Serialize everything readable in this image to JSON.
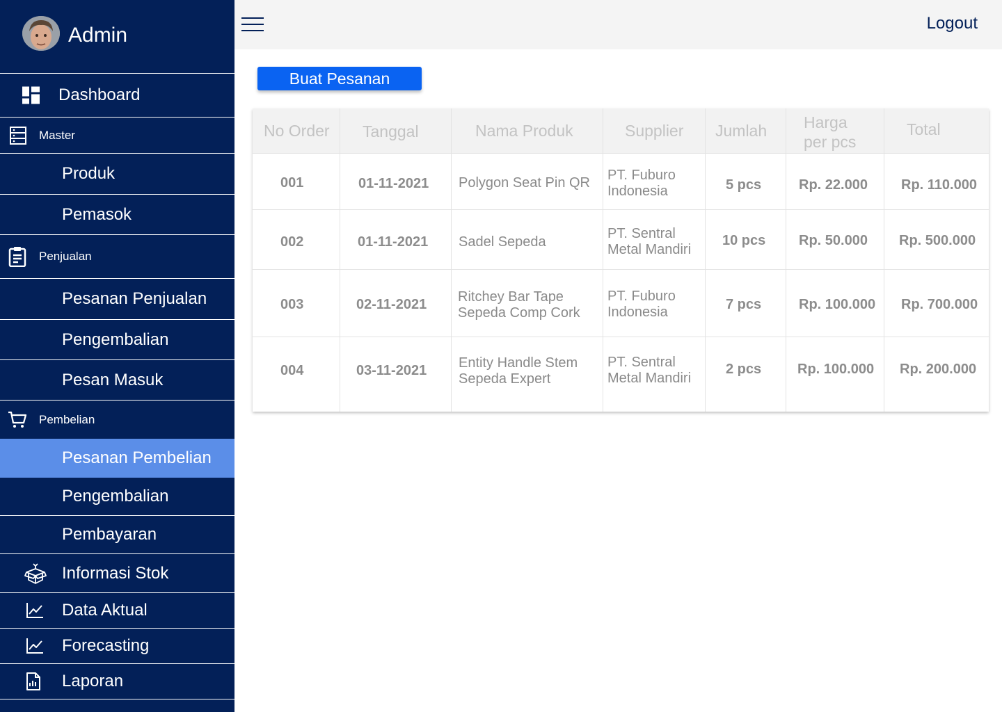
{
  "sidebar": {
    "admin_name": "Admin",
    "items": [
      {
        "label": "Dashboard",
        "icon": "dashboard-grid-icon"
      },
      {
        "label": "Master",
        "icon": "server-list-icon"
      },
      {
        "label": "Produk"
      },
      {
        "label": "Pemasok"
      },
      {
        "label": "Penjualan",
        "icon": "clipboard-icon"
      },
      {
        "label": "Pesanan Penjualan"
      },
      {
        "label": "Pengembalian"
      },
      {
        "label": "Pesan Masuk"
      },
      {
        "label": "Pembelian",
        "icon": "cart-icon"
      },
      {
        "label": "Pesanan Pembelian",
        "active": true
      },
      {
        "label": "Pengembalian"
      },
      {
        "label": "Pembayaran"
      },
      {
        "label": "Informasi Stok",
        "icon": "box-icon"
      },
      {
        "label": "Data Aktual",
        "icon": "line-chart-icon"
      },
      {
        "label": "Forecasting",
        "icon": "line-chart-icon"
      },
      {
        "label": "Laporan",
        "icon": "report-icon"
      }
    ]
  },
  "topbar": {
    "logout_label": "Logout"
  },
  "main": {
    "create_button_label": "Buat Pesanan",
    "table": {
      "headers": [
        "No Order",
        "Tanggal",
        "Nama Produk",
        "Supplier",
        "Jumlah",
        "Harga per pcs",
        "Total"
      ],
      "headers_split": {
        "harga_line1": "Harga",
        "harga_line2": "per pcs"
      },
      "rows": [
        {
          "no": "001",
          "tanggal": "01-11-2021",
          "produk_1": "Polygon Seat Pin QR",
          "produk_2": "",
          "supplier_1": "PT. Fuburo",
          "supplier_2": "Indonesia",
          "jumlah": "5 pcs",
          "harga": "Rp. 22.000",
          "total": "Rp. 110.000"
        },
        {
          "no": "002",
          "tanggal": "01-11-2021",
          "produk_1": "Sadel Sepeda",
          "produk_2": "",
          "supplier_1": "PT. Sentral",
          "supplier_2": "Metal Mandiri",
          "jumlah": "10 pcs",
          "harga": "Rp. 50.000",
          "total": "Rp. 500.000"
        },
        {
          "no": "003",
          "tanggal": "02-11-2021",
          "produk_1": "Ritchey Bar Tape",
          "produk_2": "Sepeda Comp Cork",
          "supplier_1": "PT. Fuburo",
          "supplier_2": "Indonesia",
          "jumlah": "7 pcs",
          "harga": "Rp. 100.000",
          "total": "Rp. 700.000"
        },
        {
          "no": "004",
          "tanggal": "03-11-2021",
          "produk_1": "Entity Handle Stem",
          "produk_2": "Sepeda Expert",
          "supplier_1": "PT. Sentral",
          "supplier_2": "Metal Mandiri",
          "jumlah": "2 pcs",
          "harga": "Rp. 100.000",
          "total": "Rp. 200.000"
        }
      ]
    }
  },
  "colors": {
    "sidebar_bg": "#032058",
    "active_bg": "#5b8ee8",
    "button_bg": "#0a63f2",
    "topbar_bg": "#f4f4f4"
  }
}
